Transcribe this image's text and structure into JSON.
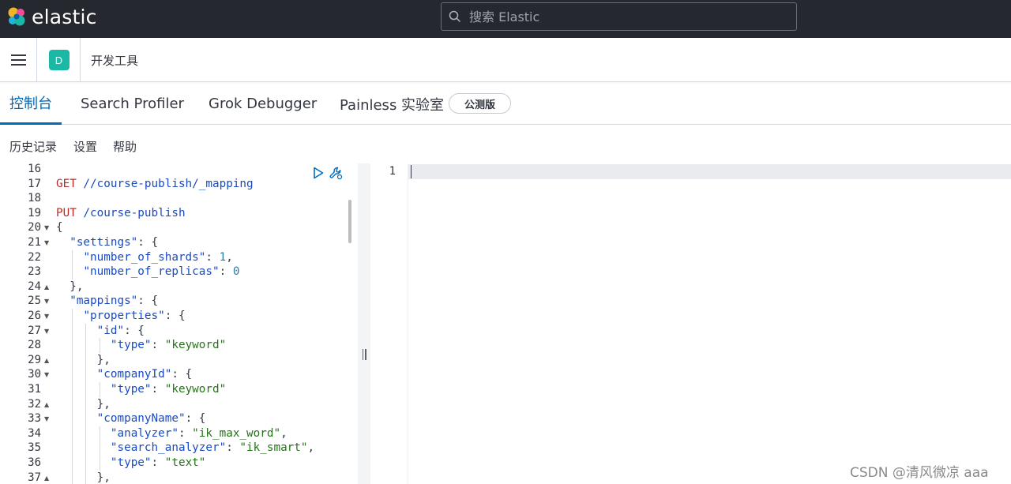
{
  "header": {
    "brand": "elastic",
    "search_placeholder": "搜索 Elastic"
  },
  "navbar": {
    "space_initial": "D",
    "breadcrumb": "开发工具"
  },
  "tabs": [
    {
      "label": "控制台",
      "active": true
    },
    {
      "label": "Search Profiler",
      "active": false
    },
    {
      "label": "Grok Debugger",
      "active": false
    },
    {
      "label": "Painless 实验室",
      "active": false
    }
  ],
  "beta_badge": "公测版",
  "submenu": {
    "history": "历史记录",
    "settings": "设置",
    "help": "帮助"
  },
  "editor": {
    "lines": [
      {
        "n": "16",
        "text": ""
      },
      {
        "n": "17",
        "text": "GET //course-publish/_mapping"
      },
      {
        "n": "18",
        "text": ""
      },
      {
        "n": "19",
        "text": "PUT /course-publish"
      },
      {
        "n": "20",
        "text": "{",
        "fold": "down"
      },
      {
        "n": "21",
        "text": "  \"settings\": {",
        "fold": "down"
      },
      {
        "n": "22",
        "text": "    \"number_of_shards\": 1,"
      },
      {
        "n": "23",
        "text": "    \"number_of_replicas\": 0"
      },
      {
        "n": "24",
        "text": "  },",
        "fold": "up"
      },
      {
        "n": "25",
        "text": "  \"mappings\": {",
        "fold": "down"
      },
      {
        "n": "26",
        "text": "    \"properties\": {",
        "fold": "down"
      },
      {
        "n": "27",
        "text": "      \"id\": {",
        "fold": "down"
      },
      {
        "n": "28",
        "text": "        \"type\": \"keyword\""
      },
      {
        "n": "29",
        "text": "      },",
        "fold": "up"
      },
      {
        "n": "30",
        "text": "      \"companyId\": {",
        "fold": "down"
      },
      {
        "n": "31",
        "text": "        \"type\": \"keyword\""
      },
      {
        "n": "32",
        "text": "      },",
        "fold": "up"
      },
      {
        "n": "33",
        "text": "      \"companyName\": {",
        "fold": "down"
      },
      {
        "n": "34",
        "text": "        \"analyzer\": \"ik_max_word\","
      },
      {
        "n": "35",
        "text": "        \"search_analyzer\": \"ik_smart\","
      },
      {
        "n": "36",
        "text": "        \"type\": \"text\""
      },
      {
        "n": "37",
        "text": "      },",
        "fold": "up"
      }
    ]
  },
  "output": {
    "line_number": "1"
  },
  "watermark": "CSDN @清风微凉 aaa",
  "colors": {
    "topbar": "#25282f",
    "accent": "#006bb8",
    "space_avatar": "#1bb8a6",
    "keyword": "#b92b27",
    "json_key": "#1a4abf",
    "json_string": "#26721a"
  }
}
